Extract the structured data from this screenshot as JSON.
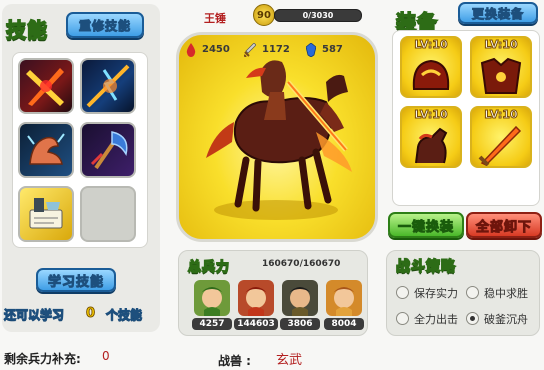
{
  "skills_panel": {
    "title": "技能",
    "reset_button": "重修技能",
    "learn_button": "学习技能",
    "remaining_prefix": "还可以学习",
    "remaining_count": "0",
    "remaining_suffix": "个技能",
    "slots": [
      {
        "icon": "crossed-blades-icon"
      },
      {
        "icon": "lightning-spear-icon"
      },
      {
        "icon": "muscle-arm-icon"
      },
      {
        "icon": "dark-axe-icon"
      },
      {
        "icon": "scroll-book-icon"
      },
      {
        "icon": "empty-slot"
      }
    ]
  },
  "hero": {
    "name": "王锤",
    "level": "90",
    "exp": "0/3030",
    "hp": "2450",
    "attack": "1172",
    "defense": "587"
  },
  "army": {
    "title": "总兵力",
    "total": "160670/160670",
    "units": [
      {
        "value": "4257",
        "icon": "general-green-avatar"
      },
      {
        "value": "144603",
        "icon": "general-red-avatar"
      },
      {
        "value": "3806",
        "icon": "general-black-avatar"
      },
      {
        "value": "8004",
        "icon": "general-orange-avatar"
      }
    ]
  },
  "equipment": {
    "title": "装备",
    "change_button": "更换装备",
    "one_click_button": "一键换装",
    "unequip_all_button": "全部卸下",
    "slots": [
      {
        "level": "LV:10",
        "icon": "helmet-icon"
      },
      {
        "level": "LV:10",
        "icon": "armor-icon"
      },
      {
        "level": "LV:10",
        "icon": "horse-icon"
      },
      {
        "level": "LV:10",
        "icon": "sword-icon"
      }
    ]
  },
  "strategy": {
    "title": "战斗策略",
    "options": [
      {
        "label": "保存实力",
        "selected": false
      },
      {
        "label": "稳中求胜",
        "selected": false
      },
      {
        "label": "全力出击",
        "selected": false
      },
      {
        "label": "破釜沉舟",
        "selected": true
      }
    ]
  },
  "footer": {
    "reinforce_label": "剩余兵力补充:",
    "reinforce_value": "0",
    "beast_label": "战兽 :",
    "beast_value": "玄武"
  },
  "colors": {
    "accent_gold": "#f5cc16",
    "beast_red": "#b32020"
  }
}
